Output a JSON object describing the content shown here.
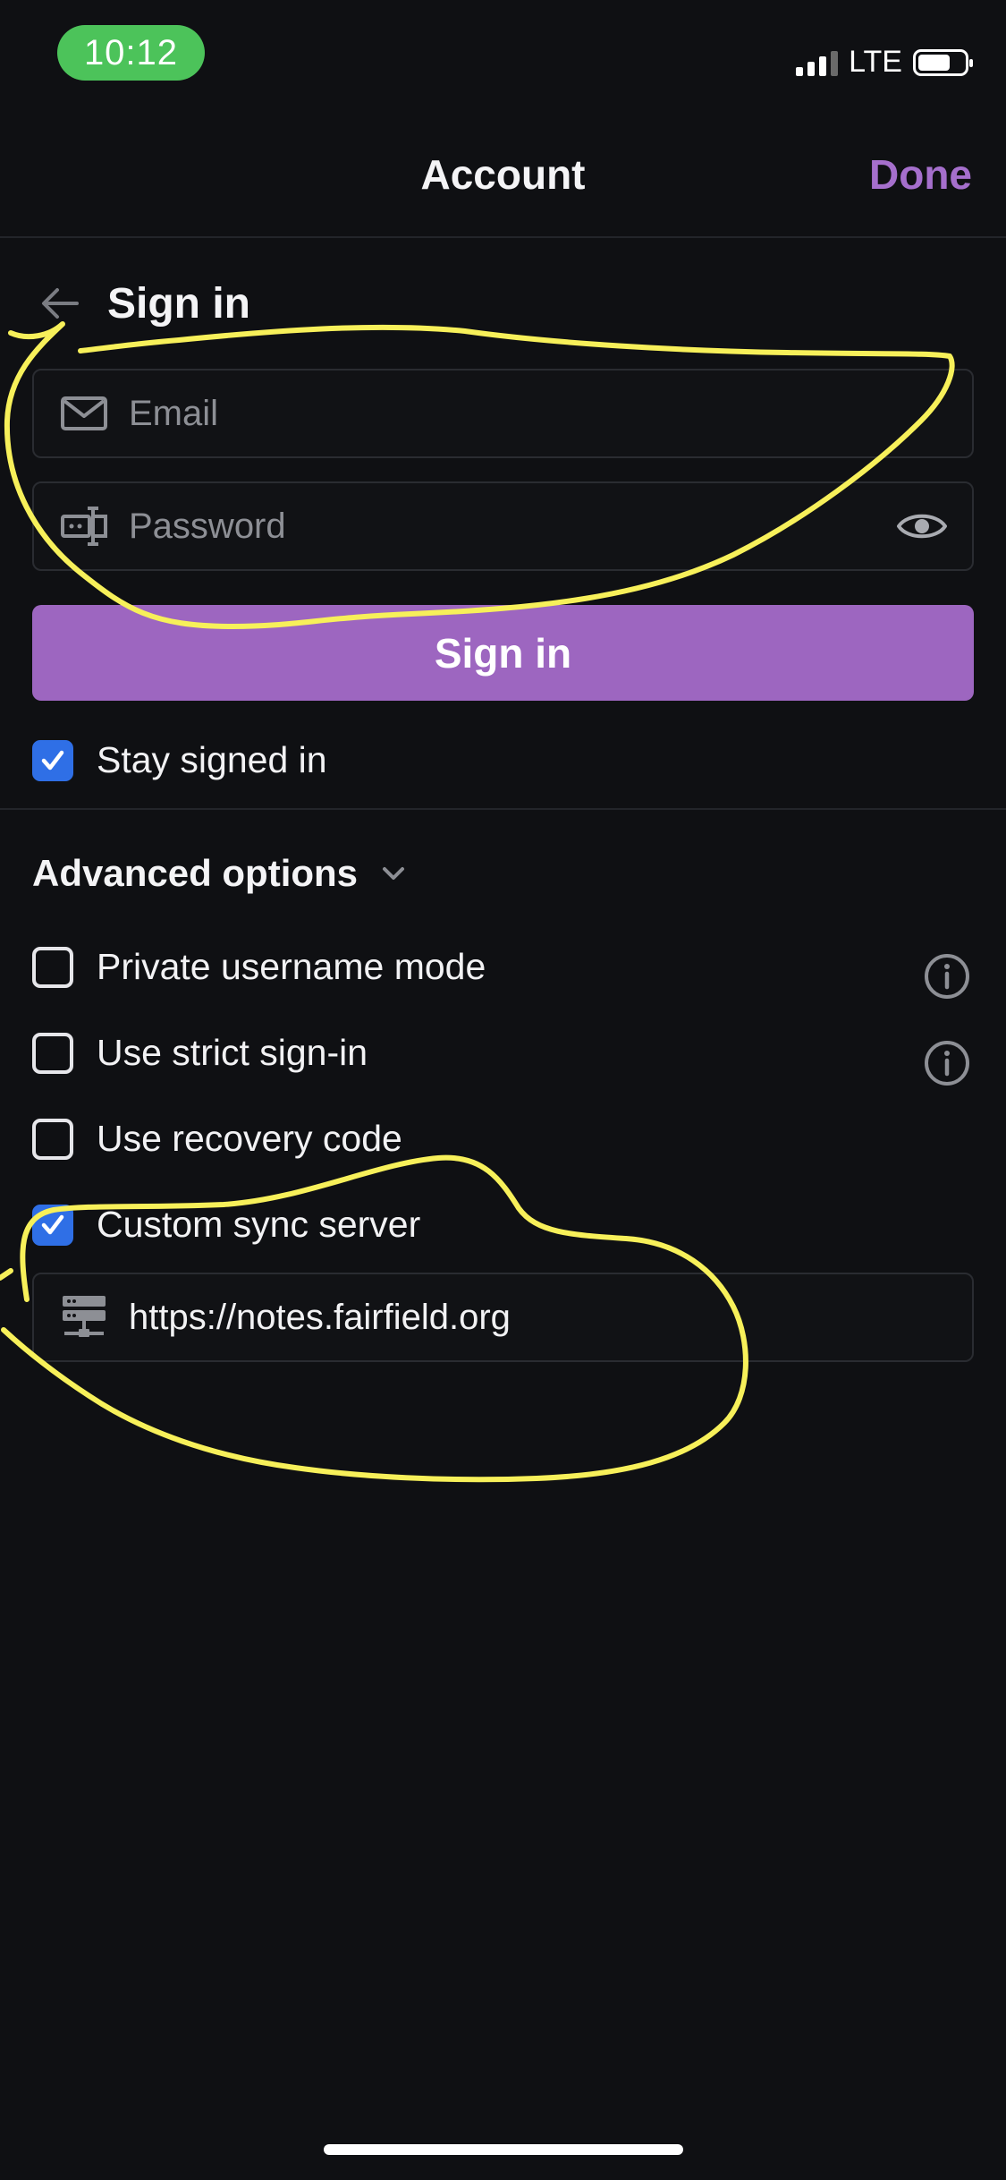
{
  "status_bar": {
    "time": "10:12",
    "network": "LTE"
  },
  "nav": {
    "title": "Account",
    "done_label": "Done"
  },
  "sign_in": {
    "title": "Sign in",
    "email_placeholder": "Email",
    "password_placeholder": "Password",
    "button_label": "Sign in",
    "stay_signed_in": {
      "label": "Stay signed in",
      "checked": true
    }
  },
  "advanced": {
    "title": "Advanced options",
    "options": [
      {
        "label": "Private username mode",
        "checked": false,
        "has_info": true
      },
      {
        "label": "Use strict sign-in",
        "checked": false,
        "has_info": true
      },
      {
        "label": "Use recovery code",
        "checked": false,
        "has_info": false
      },
      {
        "label": "Custom sync server",
        "checked": true,
        "has_info": false
      }
    ],
    "sync_server_url": "https://notes.fairfield.org"
  },
  "colors": {
    "accent": "#9d66c0",
    "done": "#a56fcc",
    "checkbox_on": "#2f6fe6",
    "annotation": "#f7f05a",
    "background": "#0f1013"
  }
}
